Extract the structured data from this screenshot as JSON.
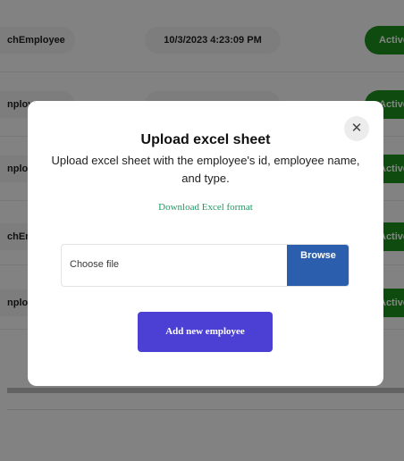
{
  "background_table": {
    "rows": [
      {
        "name": "chEmployee",
        "time": "10/3/2023 4:23:09 PM",
        "status": "Active"
      },
      {
        "name": "nploy",
        "time": "",
        "status": "Active"
      },
      {
        "name": "nploy",
        "time": "",
        "status": "Active"
      },
      {
        "name": "chEn",
        "time": "",
        "status": "Active"
      },
      {
        "name": "nploy",
        "time": "",
        "status": "Active"
      }
    ],
    "status_color": "#1e8f1e"
  },
  "modal": {
    "close_icon": "✕",
    "title": "Upload excel sheet",
    "description": "Upload excel sheet with the employee's id, employee name, and type.",
    "download_link": "Download Excel format",
    "file_placeholder": "Choose file",
    "browse_label": "Browse",
    "submit_label": "Add new employee",
    "colors": {
      "link": "#1f9a64",
      "browse": "#2b5fad",
      "submit": "#4b3fd4"
    }
  }
}
